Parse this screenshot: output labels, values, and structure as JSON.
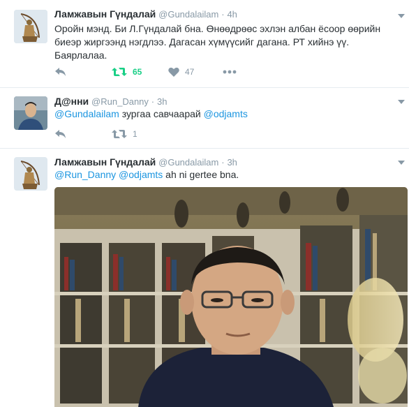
{
  "tweets": [
    {
      "name": "Ламжавын Гүндалай",
      "handle": "@Gundalailam",
      "time": "4h",
      "text": "Оройн мэнд. Би Л.Гүндалай бна. Өнөөдрөөс эхлэн албан ёсоор өөрийн биеэр жиргээнд нэгдлээ. Дагасан хүмүүсийг дагана. РТ хийнэ үү. Баярлалаа.",
      "retweets": "65",
      "likes": "47"
    },
    {
      "name": "Д@нни",
      "handle": "@Run_Danny",
      "time": "3h",
      "mention1": "@Gundalailam",
      "middle": " зургаа савчаарай ",
      "mention2": "@odjamts",
      "retweets": "1"
    },
    {
      "name": "Ламжавын Гүндалай",
      "handle": "@Gundalailam",
      "time": "3h",
      "mention1": "@Run_Danny",
      "mention2": "@odjamts",
      "rest": " ah ni gertee bna."
    }
  ],
  "dot": "·",
  "colors": {
    "retweet_active": "#19cf86",
    "mention": "#1b95e0",
    "meta": "#8899a6"
  },
  "icons": [
    "reply-icon",
    "retweet-icon",
    "heart-icon",
    "more-icon",
    "caret-down-icon"
  ]
}
